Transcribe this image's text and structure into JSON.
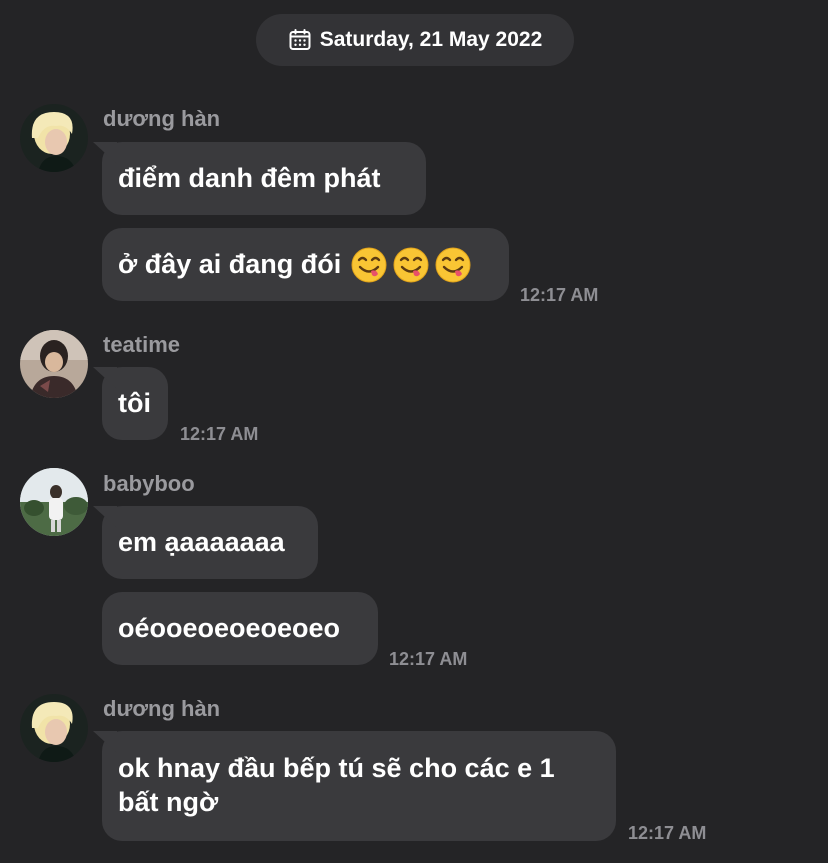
{
  "date_header": {
    "icon": "calendar-icon",
    "text": "Saturday, 21 May 2022"
  },
  "colors": {
    "background": "#242426",
    "bubble": "#3a3a3d",
    "date_pill": "#333336",
    "sender_name": "#9a9a9e",
    "timestamp": "#8e8e93",
    "text": "#ffffff"
  },
  "groups": [
    {
      "sender": "dương hàn",
      "messages": [
        {
          "text": "điểm danh đêm phát"
        },
        {
          "text": "ở đây ai đang đói",
          "emoji": [
            "face-savoring-food-emoji",
            "face-savoring-food-emoji",
            "face-savoring-food-emoji"
          ]
        }
      ],
      "time": "12:17 AM"
    },
    {
      "sender": "teatime",
      "messages": [
        {
          "text": "tôi"
        }
      ],
      "time": "12:17 AM"
    },
    {
      "sender": "babyboo",
      "messages": [
        {
          "text": "em ạaaaaaaa"
        },
        {
          "text": "oéooeoeoeoeoeo"
        }
      ],
      "time": "12:17 AM"
    },
    {
      "sender": "dương hàn",
      "messages": [
        {
          "text": "ok hnay đầu bếp tú sẽ cho các e 1 bất ngờ"
        }
      ],
      "time": "12:17 AM"
    }
  ]
}
